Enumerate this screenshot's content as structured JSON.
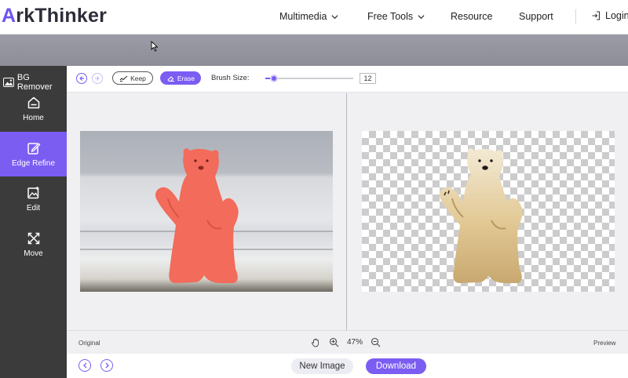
{
  "site": {
    "logo_accent": "A",
    "logo_rest": "rkThinker",
    "nav": [
      "Multimedia",
      "Free Tools",
      "Resource",
      "Support"
    ],
    "login": "Login"
  },
  "sidebar": {
    "title": "BG Remover",
    "items": [
      {
        "label": "Home",
        "icon": "home-icon"
      },
      {
        "label": "Edge Refine",
        "icon": "edge-refine-icon",
        "active": true
      },
      {
        "label": "Edit",
        "icon": "edit-image-icon"
      },
      {
        "label": "Move",
        "icon": "move-icon"
      }
    ]
  },
  "toolbar": {
    "keep_label": "Keep",
    "erase_label": "Erase",
    "brush_label": "Brush Size:",
    "brush_value": "12",
    "brush_fraction": 0.1
  },
  "status": {
    "original_label": "Original",
    "zoom": "47%",
    "preview_label": "Preview"
  },
  "footer": {
    "new_image_label": "New Image",
    "download_label": "Download"
  },
  "colors": {
    "accent": "#7b5df2",
    "sidebar_bg": "#3b3b3b",
    "highlight_mask": "#f26b5b"
  }
}
